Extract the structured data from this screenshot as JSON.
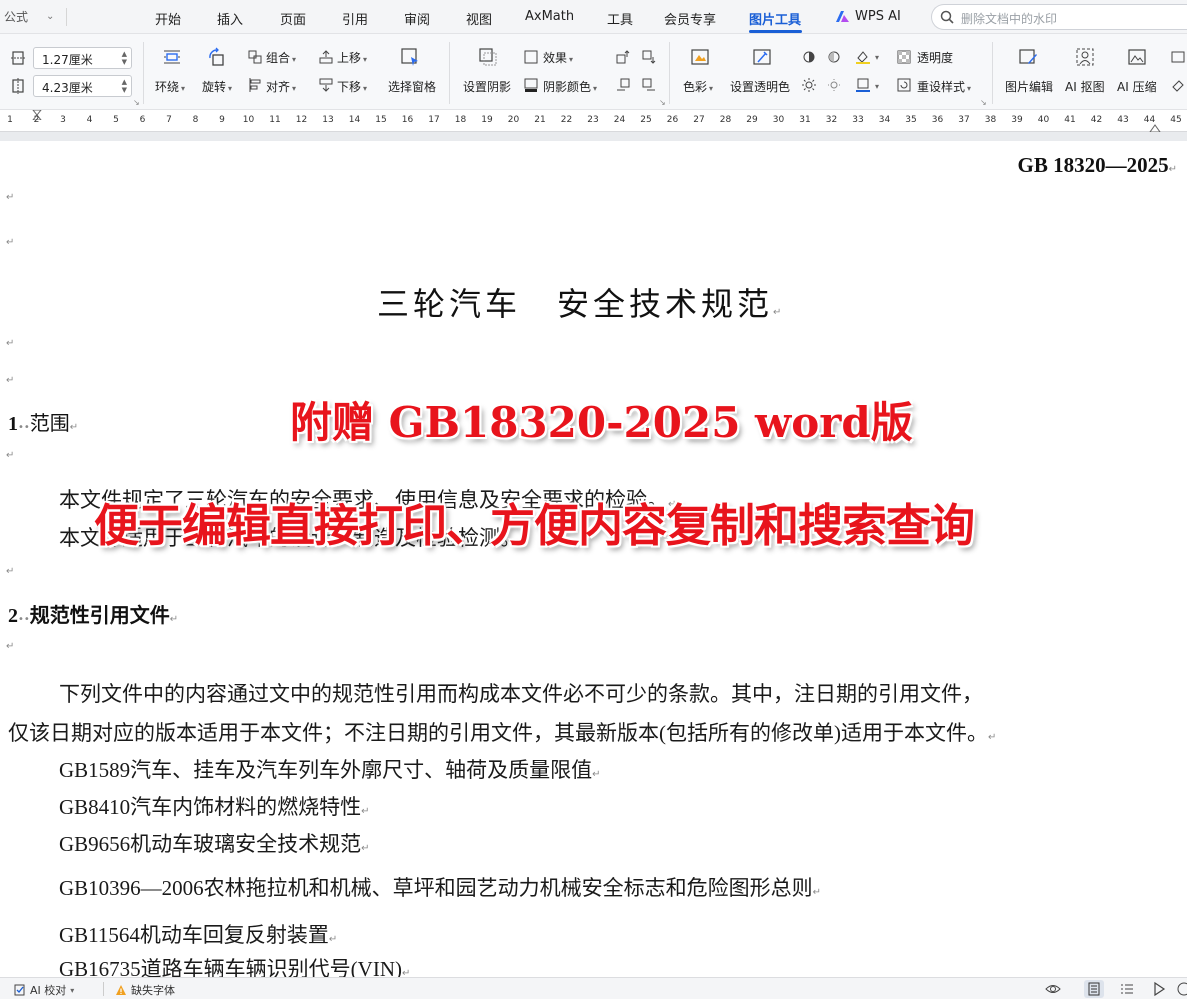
{
  "menubar": {
    "left_label": "公式",
    "tabs": [
      "开始",
      "插入",
      "页面",
      "引用",
      "审阅",
      "视图",
      "AxMath",
      "工具",
      "会员专享",
      "图片工具",
      "WPS AI"
    ],
    "active_tab": "图片工具",
    "search_placeholder": "删除文档中的水印"
  },
  "ribbon": {
    "width_value": "1.27厘米",
    "height_value": "4.23厘米",
    "wrap": "环绕",
    "rotate": "旋转",
    "group": "组合",
    "align": "对齐",
    "move_up": "上移",
    "move_down": "下移",
    "selection_pane": "选择窗格",
    "set_shadow": "设置阴影",
    "effects": "效果",
    "shadow_color": "阴影颜色",
    "color": "色彩",
    "set_transparent_color": "设置透明色",
    "transparency": "透明度",
    "reset_style": "重设样式",
    "picture_edit": "图片编辑",
    "ai_cutout": "AI 抠图",
    "ai_compress": "AI 压缩"
  },
  "ruler": {
    "numbers": [
      "1",
      "2",
      "3",
      "4",
      "5",
      "6",
      "7",
      "8",
      "9",
      "10",
      "11",
      "12",
      "13",
      "14",
      "15",
      "16",
      "17",
      "18",
      "19",
      "20",
      "21",
      "22",
      "23",
      "24",
      "25",
      "26",
      "27",
      "28",
      "29",
      "30",
      "31",
      "32",
      "33",
      "34",
      "35",
      "36",
      "37",
      "38",
      "39",
      "40",
      "41",
      "42",
      "43",
      "44",
      "45"
    ]
  },
  "document": {
    "standard_number": "GB 18320—2025",
    "title": "三轮汽车　安全技术规范",
    "section1": {
      "num": "1",
      "title": "范围"
    },
    "section1_lines": [
      "本文件规定了三轮汽车的安全要求、使用信息及安全要求的检验。",
      "本文件适用于三轮汽车的设计、制造及检验检测。"
    ],
    "section2": {
      "num": "2",
      "title": "规范性引用文件"
    },
    "section2_intro": [
      "下列文件中的内容通过文中的规范性引用而构成本文件必不可少的条款。其中，注日期的引用文件，",
      "仅该日期对应的版本适用于本文件；不注日期的引用文件，其最新版本(包括所有的修改单)适用于本文件。"
    ],
    "references": [
      "GB1589汽车、挂车及汽车列车外廓尺寸、轴荷及质量限值",
      "GB8410汽车内饰材料的燃烧特性",
      "GB9656机动车玻璃安全技术规范",
      "GB10396—2006农林拖拉机和机械、草坪和园艺动力机械安全标志和危险图形总则",
      "GB11564机动车回复反射装置",
      "GB16735道路车辆车辆识别代号(VIN)"
    ]
  },
  "overlay": {
    "line1": "附赠 GB18320-2025 word版",
    "line2": "便于编辑直接打印、方便内容复制和搜索查询",
    "color": "#e8141c"
  },
  "statusbar": {
    "ai_proofread": "AI 校对",
    "missing_fonts": "缺失字体"
  },
  "colors": {
    "accent": "#1a5fd6",
    "overlay_red": "#e8141c",
    "warning": "#f0a020"
  }
}
